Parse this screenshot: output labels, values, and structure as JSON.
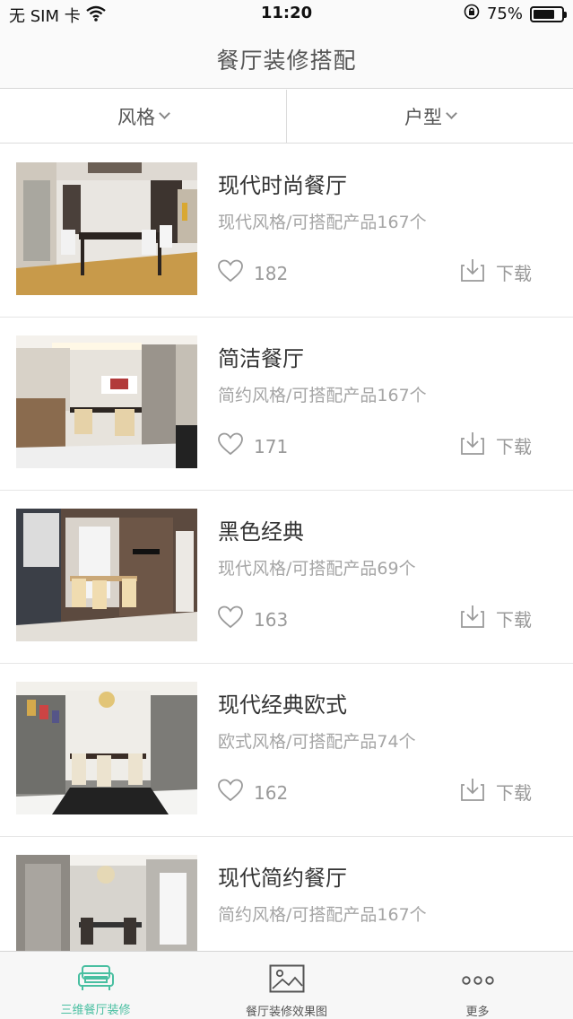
{
  "status": {
    "carrier": "无 SIM 卡",
    "time": "11:20",
    "battery": "75%",
    "battery_level": 0.75
  },
  "nav": {
    "title": "餐厅装修搭配"
  },
  "filters": [
    {
      "label": "风格"
    },
    {
      "label": "户型"
    }
  ],
  "items": [
    {
      "title": "现代时尚餐厅",
      "subtitle": "现代风格/可搭配产品167个",
      "likes": "182",
      "download_label": "下载"
    },
    {
      "title": "简洁餐厅",
      "subtitle": "简约风格/可搭配产品167个",
      "likes": "171",
      "download_label": "下载"
    },
    {
      "title": "黑色经典",
      "subtitle": "现代风格/可搭配产品69个",
      "likes": "163",
      "download_label": "下载"
    },
    {
      "title": "现代经典欧式",
      "subtitle": "欧式风格/可搭配产品74个",
      "likes": "162",
      "download_label": "下载"
    },
    {
      "title": "现代简约餐厅",
      "subtitle": "简约风格/可搭配产品167个",
      "likes": "",
      "download_label": ""
    }
  ],
  "tabs": [
    {
      "label": "三维餐厅装修",
      "icon": "sofa-icon",
      "active": true
    },
    {
      "label": "餐厅装修效果图",
      "icon": "image-icon",
      "active": false
    },
    {
      "label": "更多",
      "icon": "more-icon",
      "active": false
    }
  ],
  "colors": {
    "accent": "#49bfa1",
    "muted": "#9a9a9a"
  }
}
